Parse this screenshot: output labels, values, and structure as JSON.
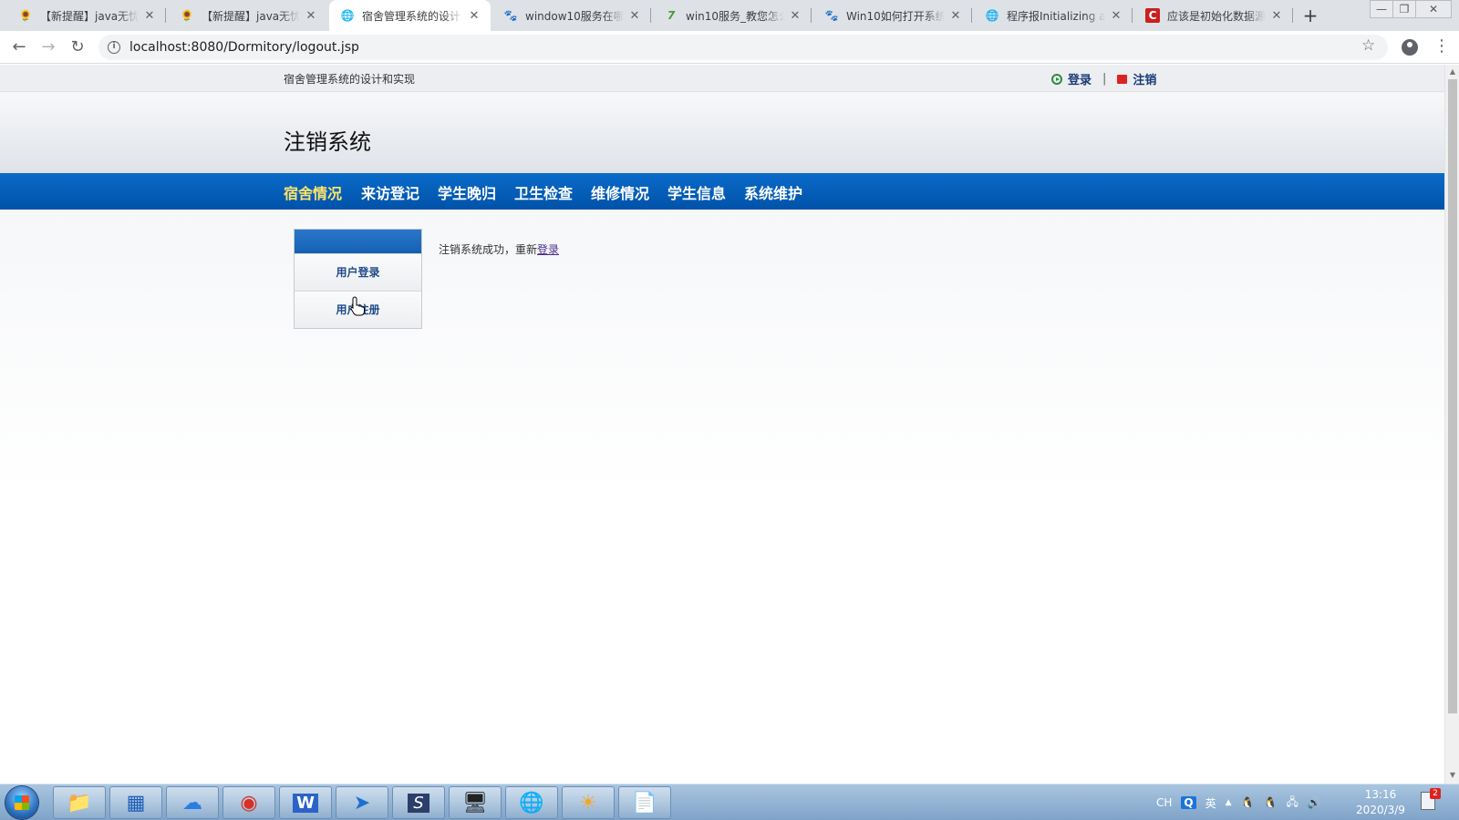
{
  "browser": {
    "tabs": [
      {
        "title": "【新提醒】java无忧",
        "favicon": "🌻",
        "active": false
      },
      {
        "title": "【新提醒】java无忧",
        "favicon": "🌻",
        "active": false
      },
      {
        "title": "宿舍管理系统的设计",
        "favicon": "🌐",
        "active": true
      },
      {
        "title": "window10服务在哪",
        "favicon": "🐾",
        "active": false
      },
      {
        "title": "win10服务_教您怎么",
        "favicon": "7",
        "active": false
      },
      {
        "title": "Win10如何打开系统",
        "favicon": "🐾",
        "active": false
      },
      {
        "title": "程序报Initializing a",
        "favicon": "🌐",
        "active": false
      },
      {
        "title": "应该是初始化数据源",
        "favicon": "C",
        "active": false
      }
    ],
    "tab_close": "✕",
    "new_tab": "+",
    "window_controls": {
      "minimize": "—",
      "maximize": "❐",
      "close": "✕"
    },
    "nav": {
      "back": "←",
      "forward": "→",
      "reload": "↻"
    },
    "address": "localhost:8080/Dormitory/logout.jsp",
    "info_glyph": "i",
    "star": "☆",
    "menu": "⋮"
  },
  "page": {
    "site_name": "宿舍管理系统的设计和实现",
    "login_label": "登录",
    "logout_label": "注销",
    "link_divider": "|",
    "title": "注销系统",
    "nav": [
      "宿舍情况",
      "来访登记",
      "学生晚归",
      "卫生检查",
      "维修情况",
      "学生信息",
      "系统维护"
    ],
    "sidebar": {
      "items": [
        "用户登录",
        "用户注册"
      ]
    },
    "message": "注销系统成功，重新",
    "message_link": "登录"
  },
  "scrollbar": {
    "up": "▲",
    "down": "▼"
  },
  "taskbar": {
    "apps": [
      {
        "name": "file-explorer",
        "glyph": "📁"
      },
      {
        "name": "app-grid",
        "glyph": "▦"
      },
      {
        "name": "baidu-netdisk",
        "glyph": "☁"
      },
      {
        "name": "chrome",
        "glyph": "◉"
      },
      {
        "name": "wps-writer",
        "glyph": "W"
      },
      {
        "name": "feishu",
        "glyph": "➤"
      },
      {
        "name": "eclipse",
        "glyph": "S"
      },
      {
        "name": "computer",
        "glyph": "🖥"
      },
      {
        "name": "network",
        "glyph": "🌐"
      },
      {
        "name": "media-player",
        "glyph": "☀"
      },
      {
        "name": "notepad",
        "glyph": "📄"
      }
    ],
    "tray": {
      "ime_code": "CH",
      "ime_mode": "英",
      "expand": "▲"
    },
    "time": "13:16",
    "date": "2020/3/9",
    "notifications": "2"
  },
  "colors": {
    "nav_bar": "#0a63c0",
    "nav_current": "#ffe46b",
    "link": "#4b2a8a"
  }
}
